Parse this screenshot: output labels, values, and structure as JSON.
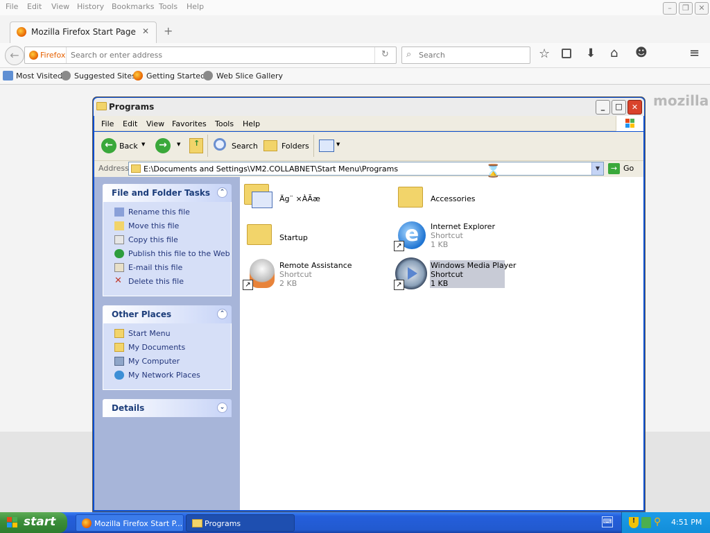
{
  "firefox": {
    "menu": [
      "File",
      "Edit",
      "View",
      "History",
      "Bookmarks",
      "Tools",
      "Help"
    ],
    "tab_title": "Mozilla Firefox Start Page",
    "identity_label": "Firefox",
    "url_placeholder": "Search or enter address",
    "search_placeholder": "Search",
    "bookmarks": [
      "Most Visited",
      "Suggested Sites",
      "Getting Started",
      "Web Slice Gallery"
    ],
    "brand": "mozilla"
  },
  "explorer": {
    "title": "Programs",
    "menu": [
      "File",
      "Edit",
      "View",
      "Favorites",
      "Tools",
      "Help"
    ],
    "toolbar": {
      "back": "Back",
      "search": "Search",
      "folders": "Folders"
    },
    "address_label": "Address",
    "address_value": "E:\\Documents and Settings\\VM2.COLLABNET\\Start Menu\\Programs",
    "go_label": "Go",
    "file_tasks": {
      "title": "File and Folder Tasks",
      "items": [
        "Rename this file",
        "Move this file",
        "Copy this file",
        "Publish this file to the Web",
        "E-mail this file",
        "Delete this file"
      ]
    },
    "other_places": {
      "title": "Other Places",
      "items": [
        "Start Menu",
        "My Documents",
        "My Computer",
        "My Network Places"
      ]
    },
    "details": {
      "title": "Details"
    },
    "files": [
      {
        "name": "Äg¨ ×ÀÃæ",
        "type": "",
        "size": ""
      },
      {
        "name": "Accessories",
        "type": "",
        "size": ""
      },
      {
        "name": "Startup",
        "type": "",
        "size": ""
      },
      {
        "name": "Internet Explorer",
        "type": "Shortcut",
        "size": "1 KB"
      },
      {
        "name": "Remote Assistance",
        "type": "Shortcut",
        "size": "2 KB"
      },
      {
        "name": "Windows Media Player",
        "type": "Shortcut",
        "size": "1 KB"
      }
    ]
  },
  "taskbar": {
    "start": "start",
    "tasks": [
      "Mozilla Firefox Start P...",
      "Programs"
    ],
    "clock": "4:51 PM"
  },
  "colors": {
    "xp_blue": "#0b4fd1",
    "xp_task_panel": "#a7b5d9",
    "start_green": "#3c8f3a",
    "ff_orange": "#e66000"
  }
}
